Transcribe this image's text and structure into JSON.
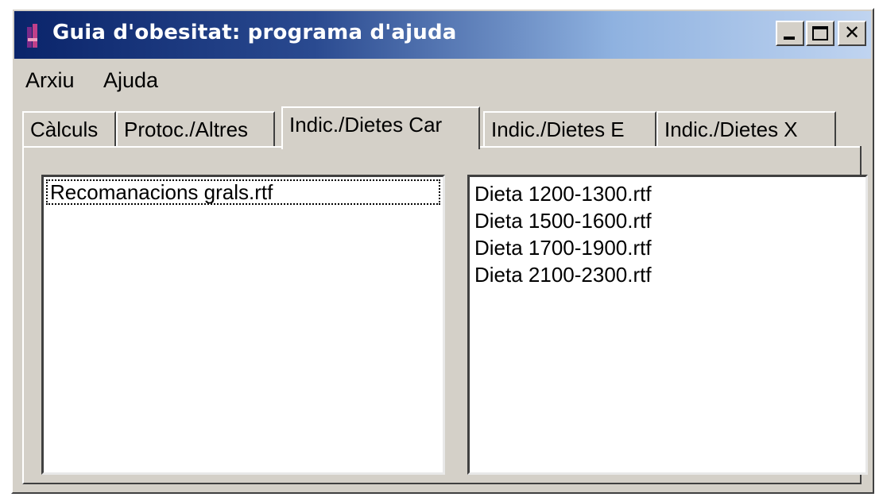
{
  "window": {
    "title": "Guia d'obesitat: programa d'ajuda",
    "icon": "app-icon",
    "controls": [
      "minimize-icon",
      "maximize-icon",
      "close-icon"
    ],
    "close_glyph": "✕"
  },
  "menubar": {
    "items": [
      "Arxiu",
      "Ajuda"
    ]
  },
  "tabs": [
    {
      "label": "Càlculs",
      "active": false
    },
    {
      "label": "Protoc./Altres",
      "active": false
    },
    {
      "label": "Indic./Dietes Car",
      "active": true
    },
    {
      "label": "Indic./Dietes E",
      "active": false
    },
    {
      "label": "Indic./Dietes X",
      "active": false
    }
  ],
  "left_list": {
    "items": [
      "Recomanacions grals.rtf"
    ],
    "focused_index": 0
  },
  "right_list": {
    "items": [
      "Dieta 1200-1300.rtf",
      "Dieta 1500-1600.rtf",
      "Dieta 1700-1900.rtf",
      "Dieta 2100-2300.rtf"
    ]
  },
  "colors": {
    "title_gradient_start": "#0a246a",
    "title_gradient_end": "#c0d4f0",
    "face": "#d4d0c8"
  }
}
